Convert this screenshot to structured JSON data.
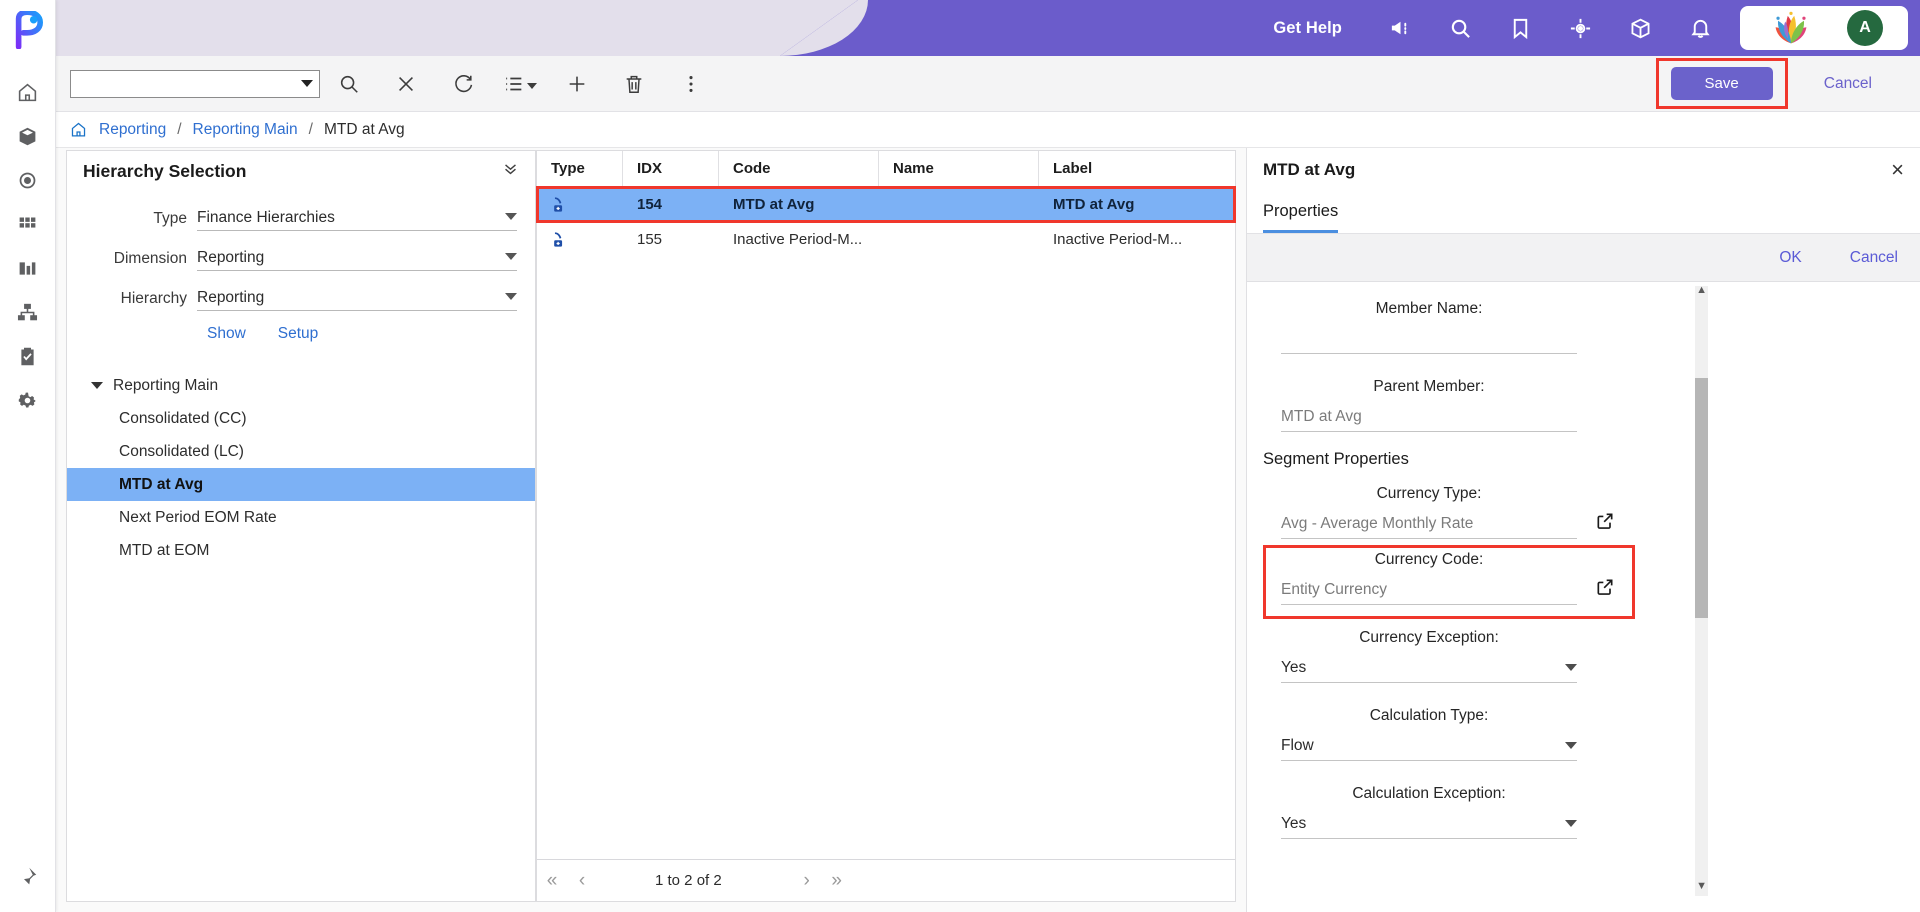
{
  "header": {
    "get_help": "Get Help",
    "icons": [
      "megaphone-icon",
      "search-icon",
      "bookmark-icon",
      "target-icon",
      "cube-icon",
      "bell-icon"
    ],
    "avatar_initial": "A",
    "purple": "#6b5ccb",
    "lavender": "#e3dfeb"
  },
  "toolbar": {
    "dropdown_value": "",
    "icons": [
      "search-icon",
      "clear-icon",
      "refresh-icon",
      "list-icon",
      "add-icon",
      "delete-icon",
      "more-icon"
    ],
    "save_label": "Save",
    "cancel_label": "Cancel",
    "highlight_color": "#f0372c"
  },
  "breadcrumb": {
    "home": "home-icon",
    "items": [
      "Reporting",
      "Reporting Main"
    ],
    "current": "MTD at Avg",
    "separator": "/"
  },
  "hierarchy_panel": {
    "title": "Hierarchy Selection",
    "fields": [
      {
        "label": "Type",
        "value": "Finance Hierarchies"
      },
      {
        "label": "Dimension",
        "value": "Reporting"
      },
      {
        "label": "Hierarchy",
        "value": "Reporting"
      }
    ],
    "actions": [
      "Show",
      "Setup"
    ],
    "tree": {
      "root": "Reporting Main",
      "children": [
        {
          "label": "Consolidated (CC)",
          "selected": false
        },
        {
          "label": "Consolidated (LC)",
          "selected": false
        },
        {
          "label": "MTD at Avg",
          "selected": true
        },
        {
          "label": "Next Period EOM Rate",
          "selected": false
        },
        {
          "label": "MTD at EOM",
          "selected": false
        }
      ]
    }
  },
  "grid": {
    "columns": [
      "Type",
      "IDX",
      "Code",
      "Name",
      "Label"
    ],
    "rows": [
      {
        "type": "member-icon",
        "idx": "154",
        "code": "MTD at Avg",
        "name": "",
        "label": "MTD at Avg",
        "selected": true
      },
      {
        "type": "member-icon",
        "idx": "155",
        "code": "Inactive Period-M...",
        "name": "",
        "label": "Inactive Period-M...",
        "selected": false
      }
    ],
    "pagination": {
      "first": "«",
      "prev": "‹",
      "text": "1 to 2 of 2",
      "next": "›",
      "last": "»"
    }
  },
  "properties": {
    "title": "MTD at Avg",
    "close": "×",
    "tabs": [
      {
        "label": "Properties",
        "active": true
      }
    ],
    "actions": {
      "ok": "OK",
      "cancel": "Cancel"
    },
    "fields": [
      {
        "label": "Member Name:",
        "value": "",
        "control": "text"
      },
      {
        "label": "Parent Member:",
        "value": "MTD at Avg",
        "control": "text"
      }
    ],
    "segment_title": "Segment Properties",
    "segment_fields": [
      {
        "label": "Currency Type:",
        "value": "Avg - Average Monthly Rate",
        "control": "link",
        "highlighted": false
      },
      {
        "label": "Currency Code:",
        "value": "Entity Currency",
        "control": "link",
        "highlighted": true
      },
      {
        "label": "Currency Exception:",
        "value": "Yes",
        "control": "select",
        "highlighted": false
      },
      {
        "label": "Calculation Type:",
        "value": "Flow",
        "control": "select",
        "highlighted": false
      },
      {
        "label": "Calculation Exception:",
        "value": "Yes",
        "control": "select",
        "highlighted": false
      }
    ]
  },
  "rail": {
    "logo": "app-logo",
    "items": [
      "home-icon",
      "cube-icon",
      "target-icon",
      "grid-icon",
      "chart-icon",
      "hierarchy-icon",
      "clipboard-icon",
      "gear-icon"
    ],
    "pin": "pin-icon"
  }
}
